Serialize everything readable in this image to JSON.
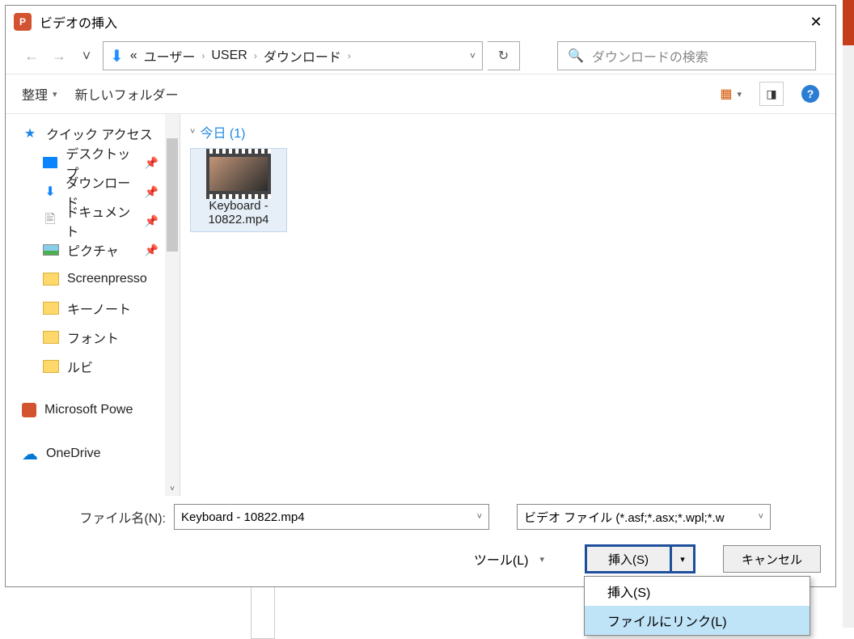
{
  "title": "ビデオの挿入",
  "nav": {
    "prefix": "«",
    "crumbs": [
      "ユーザー",
      "USER",
      "ダウンロード"
    ],
    "search_placeholder": "ダウンロードの検索"
  },
  "toolbar": {
    "organize": "整理",
    "new_folder": "新しいフォルダー"
  },
  "sidebar": {
    "quick_access": "クイック アクセス",
    "desktop": "デスクトップ",
    "downloads": "ダウンロード",
    "documents": "ドキュメント",
    "pictures": "ピクチャ",
    "f1": "Screenpresso",
    "f2": "キーノート",
    "f3": "フォント",
    "f4": "ルビ",
    "powerpoint": "Microsoft Powe",
    "onedrive": "OneDrive"
  },
  "content": {
    "group": "今日 (1)",
    "file_name": "Keyboard - 10822.mp4"
  },
  "bottom": {
    "filename_label": "ファイル名(N):",
    "filename_value": "Keyboard - 10822.mp4",
    "filetype": "ビデオ ファイル (*.asf;*.asx;*.wpl;*.w",
    "tools": "ツール(L)",
    "insert": "挿入(S)",
    "cancel": "キャンセル"
  },
  "menu": {
    "insert": "挿入(S)",
    "link": "ファイルにリンク(L)"
  }
}
